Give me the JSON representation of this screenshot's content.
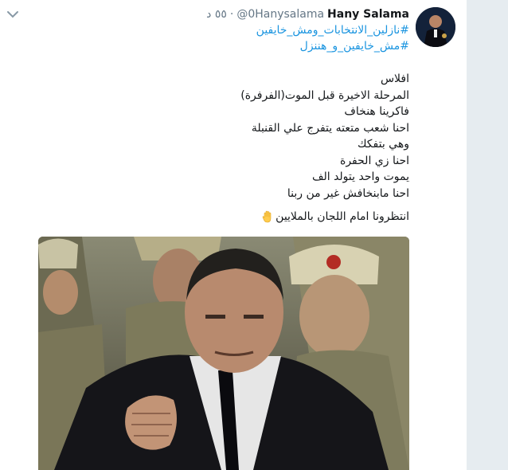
{
  "tweet": {
    "author_name": "Hany Salama",
    "author_handle": "@0Hanysalama",
    "separator": "·",
    "timestamp": "٥٥ د",
    "hashtags": [
      "#نازلين_الانتخابات_ومش_خايفين",
      "#مش_خايفين_و_هننزل"
    ],
    "lines": [
      "افلاس",
      "المرحلة الاخيرة قبل الموت(الفرفرة)",
      "فاكرينا هنخاف",
      "احنا شعب متعته يتفرج علي القنبلة",
      "وهي بتفكك",
      "احنا زي الحفرة",
      "يموت واحد يتولد الف",
      "احنا مابنخافش غير من ربنا"
    ],
    "call_to_action": "انتظرونا امام اللجان بالملايين"
  },
  "icons": {
    "menu": "chevron-down-icon",
    "hand": "raised-hand-icon"
  },
  "colors": {
    "link": "#1b95e0",
    "muted": "#657786",
    "gutter": "#e6ecf0"
  }
}
